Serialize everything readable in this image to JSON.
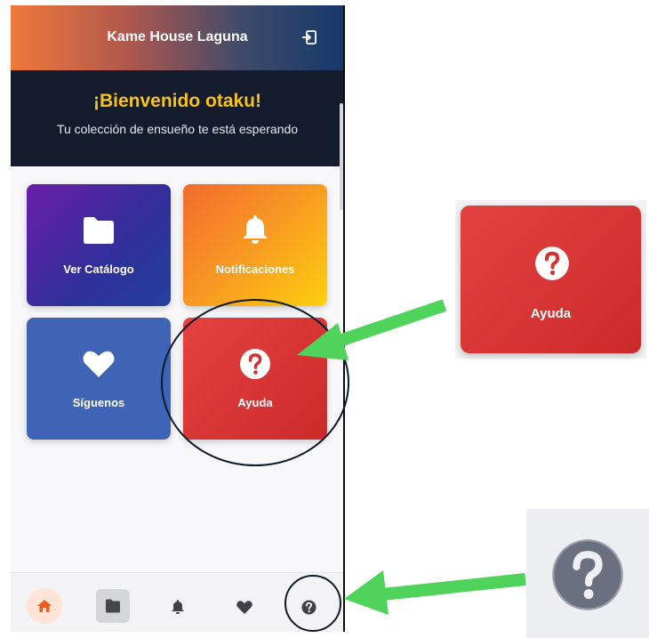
{
  "header": {
    "title": "Kame House Laguna",
    "logout_icon": "logout-icon"
  },
  "welcome": {
    "title": "¡Bienvenido otaku!",
    "subtitle": "Tu colección de ensueño te está esperando"
  },
  "cards": [
    {
      "label": "Ver Catálogo",
      "icon": "folder-icon"
    },
    {
      "label": "Notificaciones",
      "icon": "bell-icon"
    },
    {
      "label": "Síguenos",
      "icon": "heart-icon"
    },
    {
      "label": "Ayuda",
      "icon": "help-icon"
    }
  ],
  "bottom_nav": [
    "home-icon",
    "folder-icon",
    "bell-icon",
    "heart-icon",
    "help-icon"
  ],
  "zoom": {
    "label": "Ayuda"
  },
  "colors": {
    "accent_green": "#4fd35a",
    "highlight_circle": "#0e1a2a",
    "welcome_title": "#f7c21a"
  }
}
